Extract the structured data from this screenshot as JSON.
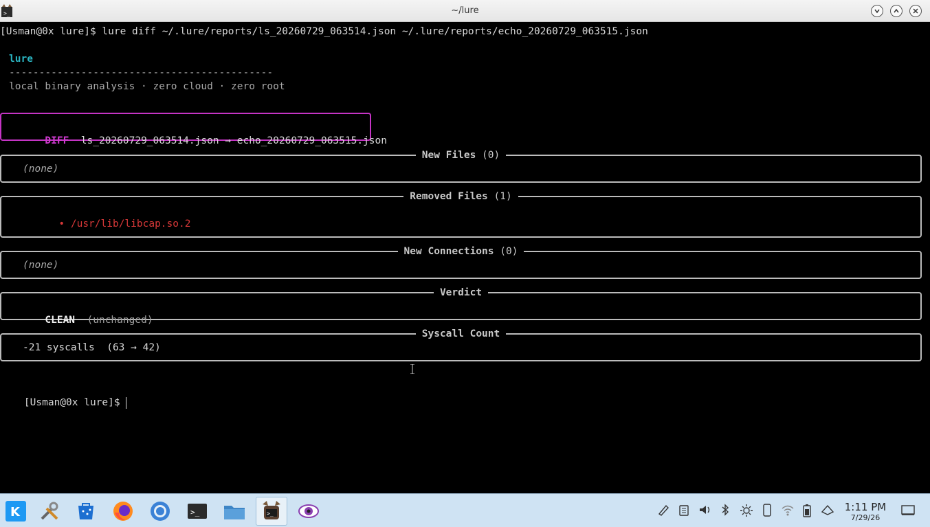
{
  "window": {
    "title": "~/lure"
  },
  "terminal": {
    "command_line": "[Usman@0x lure]$ lure diff ~/.lure/reports/ls_20260729_063514.json ~/.lure/reports/echo_20260729_063515.json",
    "banner": {
      "name": "lure",
      "rule": "--------------------------------------------",
      "tagline": "local binary analysis · zero cloud · zero root"
    },
    "diff": {
      "tag": "DIFF",
      "files": "ls_20260729_063514.json → echo_20260729_063515.json"
    },
    "panels": {
      "new_files": {
        "title": "New Files",
        "count": "(0)",
        "body": "(none)"
      },
      "removed_files": {
        "title": "Removed Files",
        "count": "(1)",
        "bullet": "•",
        "item": "/usr/lib/libcap.so.2"
      },
      "new_connections": {
        "title": "New Connections",
        "count": "(0)",
        "body": "(none)"
      },
      "verdict": {
        "title": "Verdict",
        "value": "CLEAN",
        "note": "(unchanged)"
      },
      "syscall_count": {
        "title": "Syscall Count",
        "value": "-21 syscalls  (63 → 42)"
      }
    },
    "prompt": "[Usman@0x lure]$ "
  },
  "taskbar": {
    "items": [
      "kde-menu-icon",
      "settings-tools-icon",
      "discover-icon",
      "firefox-icon",
      "chrome-icon",
      "terminal-icon",
      "file-manager-icon",
      "lure-terminal-icon",
      "eye-app-icon"
    ],
    "tray": [
      "pen-icon",
      "clipboard-icon",
      "volume-icon",
      "bluetooth-icon",
      "brightness-icon",
      "phone-icon",
      "wifi-icon",
      "battery-icon",
      "network-icon"
    ],
    "clock": {
      "time": "1:11 PM",
      "date": "7/29/26"
    }
  },
  "colors": {
    "accent_cyan": "#2ab3c0",
    "diff_magenta": "#c534c5",
    "removed_red": "#d73838",
    "taskbar": "#cfe3f3"
  }
}
